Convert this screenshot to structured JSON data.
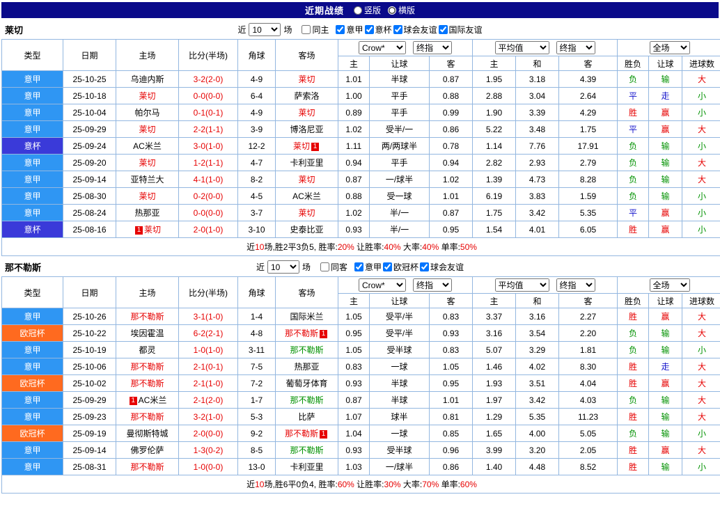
{
  "palette": {
    "red": "#e60000",
    "green": "#009100",
    "blue": "#1414cc",
    "lg": "#2f96f3",
    "cup": "#3a3ad9",
    "ucl": "#ff6a1f",
    "titlebar_bg": "#0a0a8a",
    "grid": "#93b7e0"
  },
  "titlebar": {
    "title": "近期战绩",
    "radios": [
      {
        "label": "竖版",
        "checked": false
      },
      {
        "label": "横版",
        "checked": true
      }
    ]
  },
  "header": {
    "cols": [
      "类型",
      "日期",
      "主场",
      "比分(半场)",
      "角球",
      "客场"
    ],
    "sub": [
      "主",
      "让球",
      "客",
      "主",
      "和",
      "客",
      "胜负",
      "让球",
      "进球数"
    ],
    "selects": {
      "bookmaker": "Crow*",
      "final": "终指",
      "average": "平均值",
      "fulltime": "全场"
    }
  },
  "sections": [
    {
      "team": "莱切",
      "filter": {
        "near": "近",
        "count": "10",
        "games": "场",
        "checkboxes": [
          {
            "label": "同主",
            "checked": false
          },
          {
            "label": "意甲",
            "checked": true
          },
          {
            "label": "意杯",
            "checked": true
          },
          {
            "label": "球会友谊",
            "checked": true
          },
          {
            "label": "国际友谊",
            "checked": true
          }
        ]
      },
      "rows": [
        {
          "type": "意甲",
          "tc": "lg",
          "date": "25-10-25",
          "home": {
            "n": "乌迪内斯"
          },
          "score": "3-2(2-0)",
          "corner": "4-9",
          "away": {
            "n": "莱切",
            "c": "red"
          },
          "o": [
            "1.01",
            "半球",
            "0.87"
          ],
          "e": [
            "1.95",
            "3.18",
            "4.39"
          ],
          "r": [
            [
              "负",
              "green"
            ],
            [
              "输",
              "green"
            ],
            [
              "大",
              "red"
            ]
          ]
        },
        {
          "type": "意甲",
          "tc": "lg",
          "date": "25-10-18",
          "home": {
            "n": "莱切",
            "c": "red"
          },
          "score": "0-0(0-0)",
          "corner": "6-4",
          "away": {
            "n": "萨索洛"
          },
          "o": [
            "1.00",
            "平手",
            "0.88"
          ],
          "e": [
            "2.88",
            "3.04",
            "2.64"
          ],
          "r": [
            [
              "平",
              "blue"
            ],
            [
              "走",
              "blue"
            ],
            [
              "小",
              "green"
            ]
          ]
        },
        {
          "type": "意甲",
          "tc": "lg",
          "date": "25-10-04",
          "home": {
            "n": "帕尔马"
          },
          "score": "0-1(0-1)",
          "corner": "4-9",
          "away": {
            "n": "莱切",
            "c": "red"
          },
          "o": [
            "0.89",
            "平手",
            "0.99"
          ],
          "e": [
            "1.90",
            "3.39",
            "4.29"
          ],
          "r": [
            [
              "胜",
              "red"
            ],
            [
              "赢",
              "red"
            ],
            [
              "小",
              "green"
            ]
          ]
        },
        {
          "type": "意甲",
          "tc": "lg",
          "date": "25-09-29",
          "home": {
            "n": "莱切",
            "c": "red"
          },
          "score": "2-2(1-1)",
          "corner": "3-9",
          "away": {
            "n": "博洛尼亚"
          },
          "o": [
            "1.02",
            "受半/一",
            "0.86"
          ],
          "e": [
            "5.22",
            "3.48",
            "1.75"
          ],
          "r": [
            [
              "平",
              "blue"
            ],
            [
              "赢",
              "red"
            ],
            [
              "大",
              "red"
            ]
          ]
        },
        {
          "type": "意杯",
          "tc": "cup",
          "date": "25-09-24",
          "home": {
            "n": "AC米兰"
          },
          "score": "3-0(1-0)",
          "corner": "12-2",
          "away": {
            "n": "莱切",
            "c": "red",
            "b": "1"
          },
          "o": [
            "1.11",
            "两/两球半",
            "0.78"
          ],
          "e": [
            "1.14",
            "7.76",
            "17.91"
          ],
          "r": [
            [
              "负",
              "green"
            ],
            [
              "输",
              "green"
            ],
            [
              "小",
              "green"
            ]
          ]
        },
        {
          "type": "意甲",
          "tc": "lg",
          "date": "25-09-20",
          "home": {
            "n": "莱切",
            "c": "red"
          },
          "score": "1-2(1-1)",
          "corner": "4-7",
          "away": {
            "n": "卡利亚里"
          },
          "o": [
            "0.94",
            "平手",
            "0.94"
          ],
          "e": [
            "2.82",
            "2.93",
            "2.79"
          ],
          "r": [
            [
              "负",
              "green"
            ],
            [
              "输",
              "green"
            ],
            [
              "大",
              "red"
            ]
          ]
        },
        {
          "type": "意甲",
          "tc": "lg",
          "date": "25-09-14",
          "home": {
            "n": "亚特兰大"
          },
          "score": "4-1(1-0)",
          "corner": "8-2",
          "away": {
            "n": "莱切",
            "c": "red"
          },
          "o": [
            "0.87",
            "一/球半",
            "1.02"
          ],
          "e": [
            "1.39",
            "4.73",
            "8.28"
          ],
          "r": [
            [
              "负",
              "green"
            ],
            [
              "输",
              "green"
            ],
            [
              "大",
              "red"
            ]
          ]
        },
        {
          "type": "意甲",
          "tc": "lg",
          "date": "25-08-30",
          "home": {
            "n": "莱切",
            "c": "red"
          },
          "score": "0-2(0-0)",
          "corner": "4-5",
          "away": {
            "n": "AC米兰"
          },
          "o": [
            "0.88",
            "受一球",
            "1.01"
          ],
          "e": [
            "6.19",
            "3.83",
            "1.59"
          ],
          "r": [
            [
              "负",
              "green"
            ],
            [
              "输",
              "green"
            ],
            [
              "小",
              "green"
            ]
          ]
        },
        {
          "type": "意甲",
          "tc": "lg",
          "date": "25-08-24",
          "home": {
            "n": "热那亚"
          },
          "score": "0-0(0-0)",
          "corner": "3-7",
          "away": {
            "n": "莱切",
            "c": "red"
          },
          "o": [
            "1.02",
            "半/一",
            "0.87"
          ],
          "e": [
            "1.75",
            "3.42",
            "5.35"
          ],
          "r": [
            [
              "平",
              "blue"
            ],
            [
              "赢",
              "red"
            ],
            [
              "小",
              "green"
            ]
          ]
        },
        {
          "type": "意杯",
          "tc": "cup",
          "date": "25-08-16",
          "home": {
            "n": "莱切",
            "c": "red",
            "b": "1"
          },
          "score": "2-0(1-0)",
          "corner": "3-10",
          "away": {
            "n": "史泰比亚"
          },
          "o": [
            "0.93",
            "半/一",
            "0.95"
          ],
          "e": [
            "1.54",
            "4.01",
            "6.05"
          ],
          "r": [
            [
              "胜",
              "red"
            ],
            [
              "赢",
              "red"
            ],
            [
              "小",
              "green"
            ]
          ]
        }
      ],
      "summary": [
        {
          "t": "近"
        },
        {
          "t": "10",
          "red": true
        },
        {
          "t": "场,胜2平3负5, 胜率:"
        },
        {
          "t": "20%",
          "red": true
        },
        {
          "t": " 让胜率:"
        },
        {
          "t": "40%",
          "red": true
        },
        {
          "t": " 大率:"
        },
        {
          "t": "40%",
          "red": true
        },
        {
          "t": " 单率:"
        },
        {
          "t": "50%",
          "red": true
        }
      ]
    },
    {
      "team": "那不勒斯",
      "filter": {
        "near": "近",
        "count": "10",
        "games": "场",
        "checkboxes": [
          {
            "label": "同客",
            "checked": false
          },
          {
            "label": "意甲",
            "checked": true
          },
          {
            "label": "欧冠杯",
            "checked": true
          },
          {
            "label": "球会友谊",
            "checked": true
          }
        ]
      },
      "rows": [
        {
          "type": "意甲",
          "tc": "lg",
          "date": "25-10-26",
          "home": {
            "n": "那不勒斯",
            "c": "red"
          },
          "score": "3-1(1-0)",
          "corner": "1-4",
          "away": {
            "n": "国际米兰"
          },
          "o": [
            "1.05",
            "受平/半",
            "0.83"
          ],
          "e": [
            "3.37",
            "3.16",
            "2.27"
          ],
          "r": [
            [
              "胜",
              "red"
            ],
            [
              "赢",
              "red"
            ],
            [
              "大",
              "red"
            ]
          ]
        },
        {
          "type": "欧冠杯",
          "tc": "ucl",
          "date": "25-10-22",
          "home": {
            "n": "埃因霍温"
          },
          "score": "6-2(2-1)",
          "corner": "4-8",
          "away": {
            "n": "那不勒斯",
            "c": "red",
            "b": "1"
          },
          "o": [
            "0.95",
            "受平/半",
            "0.93"
          ],
          "e": [
            "3.16",
            "3.54",
            "2.20"
          ],
          "r": [
            [
              "负",
              "green"
            ],
            [
              "输",
              "green"
            ],
            [
              "大",
              "red"
            ]
          ]
        },
        {
          "type": "意甲",
          "tc": "lg",
          "date": "25-10-19",
          "home": {
            "n": "都灵"
          },
          "score": "1-0(1-0)",
          "corner": "3-11",
          "away": {
            "n": "那不勒斯",
            "c": "green"
          },
          "o": [
            "1.05",
            "受半球",
            "0.83"
          ],
          "e": [
            "5.07",
            "3.29",
            "1.81"
          ],
          "r": [
            [
              "负",
              "green"
            ],
            [
              "输",
              "green"
            ],
            [
              "小",
              "green"
            ]
          ]
        },
        {
          "type": "意甲",
          "tc": "lg",
          "date": "25-10-06",
          "home": {
            "n": "那不勒斯",
            "c": "red"
          },
          "score": "2-1(0-1)",
          "corner": "7-5",
          "away": {
            "n": "热那亚"
          },
          "o": [
            "0.83",
            "一球",
            "1.05"
          ],
          "e": [
            "1.46",
            "4.02",
            "8.30"
          ],
          "r": [
            [
              "胜",
              "red"
            ],
            [
              "走",
              "blue"
            ],
            [
              "大",
              "red"
            ]
          ]
        },
        {
          "type": "欧冠杯",
          "tc": "ucl",
          "date": "25-10-02",
          "home": {
            "n": "那不勒斯",
            "c": "red"
          },
          "score": "2-1(1-0)",
          "corner": "7-2",
          "away": {
            "n": "葡萄牙体育"
          },
          "o": [
            "0.93",
            "半球",
            "0.95"
          ],
          "e": [
            "1.93",
            "3.51",
            "4.04"
          ],
          "r": [
            [
              "胜",
              "red"
            ],
            [
              "赢",
              "red"
            ],
            [
              "大",
              "red"
            ]
          ]
        },
        {
          "type": "意甲",
          "tc": "lg",
          "date": "25-09-29",
          "home": {
            "n": "AC米兰",
            "b": "1"
          },
          "score": "2-1(2-0)",
          "corner": "1-7",
          "away": {
            "n": "那不勒斯",
            "c": "green"
          },
          "o": [
            "0.87",
            "半球",
            "1.01"
          ],
          "e": [
            "1.97",
            "3.42",
            "4.03"
          ],
          "r": [
            [
              "负",
              "green"
            ],
            [
              "输",
              "green"
            ],
            [
              "大",
              "red"
            ]
          ]
        },
        {
          "type": "意甲",
          "tc": "lg",
          "date": "25-09-23",
          "home": {
            "n": "那不勒斯",
            "c": "red"
          },
          "score": "3-2(1-0)",
          "corner": "5-3",
          "away": {
            "n": "比萨"
          },
          "o": [
            "1.07",
            "球半",
            "0.81"
          ],
          "e": [
            "1.29",
            "5.35",
            "11.23"
          ],
          "r": [
            [
              "胜",
              "red"
            ],
            [
              "输",
              "green"
            ],
            [
              "大",
              "red"
            ]
          ]
        },
        {
          "type": "欧冠杯",
          "tc": "ucl",
          "date": "25-09-19",
          "home": {
            "n": "曼彻斯特城"
          },
          "score": "2-0(0-0)",
          "corner": "9-2",
          "away": {
            "n": "那不勒斯",
            "c": "red",
            "b": "1"
          },
          "o": [
            "1.04",
            "一球",
            "0.85"
          ],
          "e": [
            "1.65",
            "4.00",
            "5.05"
          ],
          "r": [
            [
              "负",
              "green"
            ],
            [
              "输",
              "green"
            ],
            [
              "小",
              "green"
            ]
          ]
        },
        {
          "type": "意甲",
          "tc": "lg",
          "date": "25-09-14",
          "home": {
            "n": "佛罗伦萨"
          },
          "score": "1-3(0-2)",
          "corner": "8-5",
          "away": {
            "n": "那不勒斯",
            "c": "green"
          },
          "o": [
            "0.93",
            "受半球",
            "0.96"
          ],
          "e": [
            "3.99",
            "3.20",
            "2.05"
          ],
          "r": [
            [
              "胜",
              "red"
            ],
            [
              "赢",
              "red"
            ],
            [
              "大",
              "red"
            ]
          ]
        },
        {
          "type": "意甲",
          "tc": "lg",
          "date": "25-08-31",
          "home": {
            "n": "那不勒斯",
            "c": "red"
          },
          "score": "1-0(0-0)",
          "corner": "13-0",
          "away": {
            "n": "卡利亚里"
          },
          "o": [
            "1.03",
            "一/球半",
            "0.86"
          ],
          "e": [
            "1.40",
            "4.48",
            "8.52"
          ],
          "r": [
            [
              "胜",
              "red"
            ],
            [
              "输",
              "green"
            ],
            [
              "小",
              "green"
            ]
          ]
        }
      ],
      "summary": [
        {
          "t": "近"
        },
        {
          "t": "10",
          "red": true
        },
        {
          "t": "场,胜6平0负4, 胜率:"
        },
        {
          "t": "60%",
          "red": true
        },
        {
          "t": " 让胜率:"
        },
        {
          "t": "30%",
          "red": true
        },
        {
          "t": " 大率:"
        },
        {
          "t": "70%",
          "red": true
        },
        {
          "t": " 单率:"
        },
        {
          "t": "60%",
          "red": true
        }
      ]
    }
  ]
}
